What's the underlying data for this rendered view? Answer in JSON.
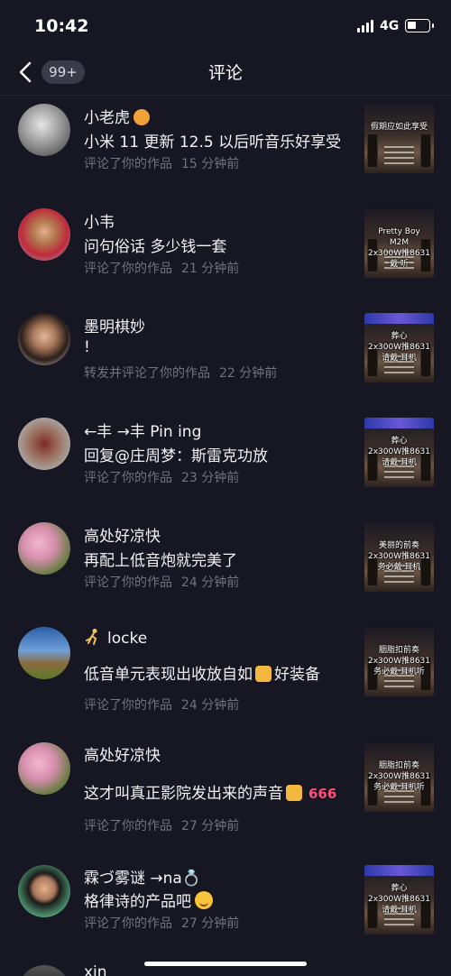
{
  "status_bar": {
    "time": "10:42",
    "network": "4G",
    "battery_level": 0.3
  },
  "nav": {
    "back_label": "back",
    "badge": "99+",
    "title": "评论"
  },
  "comments": [
    {
      "name": "小老虎",
      "name_emoji": "tiger-emoji",
      "text": "小米 11 更新 12.5 以后听音乐好享受",
      "action": "评论了你的作品",
      "time": "15 分钟前",
      "thumb_caption": "假期应如此享受",
      "avatar_colors": [
        "#c9c9c9",
        "#5a5a5a"
      ]
    },
    {
      "name": "小韦",
      "text": "问句俗话 多少钱一套",
      "action": "评论了你的作品",
      "time": "21 分钟前",
      "thumb_caption": "Pretty Boy\nM2M\n2x300W推8631\n戴  听",
      "avatar_colors": [
        "#c02a3c",
        "#8fb0c8"
      ]
    },
    {
      "name": "墨明棋妙",
      "text": "!",
      "action": "转发并评论了你的作品",
      "time": "22 分钟前",
      "thumb_caption": "葬心\n2x300W推8631\n请戴  耳机",
      "avatar_colors": [
        "#2a1e1a",
        "#e8e1da"
      ]
    },
    {
      "name": "←丰 →丰 Pin ing",
      "text": "回复@庄周梦：斯雷克功放",
      "action": "评论了你的作品",
      "time": "23 分钟前",
      "thumb_caption": "葬心\n2x300W推8631\n请戴  耳机",
      "avatar_colors": [
        "#a8a09a",
        "#7a2a22"
      ]
    },
    {
      "name": "高处好凉快",
      "text": "再配上低音炮就完美了",
      "action": "评论了你的作品",
      "time": "24 分钟前",
      "thumb_caption": "美丽的前奏\n2x300W推8631\n务必戴  耳机",
      "avatar_colors": [
        "#d98fb0",
        "#5f7a3a"
      ]
    },
    {
      "name": "locke",
      "name_emoji": "runner-emoji",
      "text": "低音单元表现出收放自如",
      "text_suffix": "好装备",
      "text_emoji": "thumbs-up-emoji",
      "action": "评论了你的作品",
      "time": "24 分钟前",
      "thumb_caption": "胭脂扣前奏\n2x300W推8631\n务必戴  耳机听",
      "avatar_colors": [
        "#3b6fb5",
        "#6a8a3a"
      ]
    },
    {
      "name": "高处好凉快",
      "text": "这才叫真正影院发出来的声音",
      "text_emoji": "thumbs-up-emoji",
      "text_suffix": "666",
      "action": "评论了你的作品",
      "time": "27 分钟前",
      "thumb_caption": "胭脂扣前奏\n2x300W推8631\n务必戴  耳机听",
      "avatar_colors": [
        "#d98fb0",
        "#5f7a3a"
      ]
    },
    {
      "name": "霖づ雾谜 →na",
      "name_suffix": "💍",
      "text": "格律诗的产品吧",
      "text_emoji": "smile-emoji",
      "action": "评论了你的作品",
      "time": "27 分钟前",
      "thumb_caption": "葬心\n2x300W推8631\n请戴  耳机",
      "avatar_colors": [
        "#4a8f6a",
        "#c8d0d8"
      ]
    }
  ],
  "partial_next": {
    "name": "xin"
  }
}
